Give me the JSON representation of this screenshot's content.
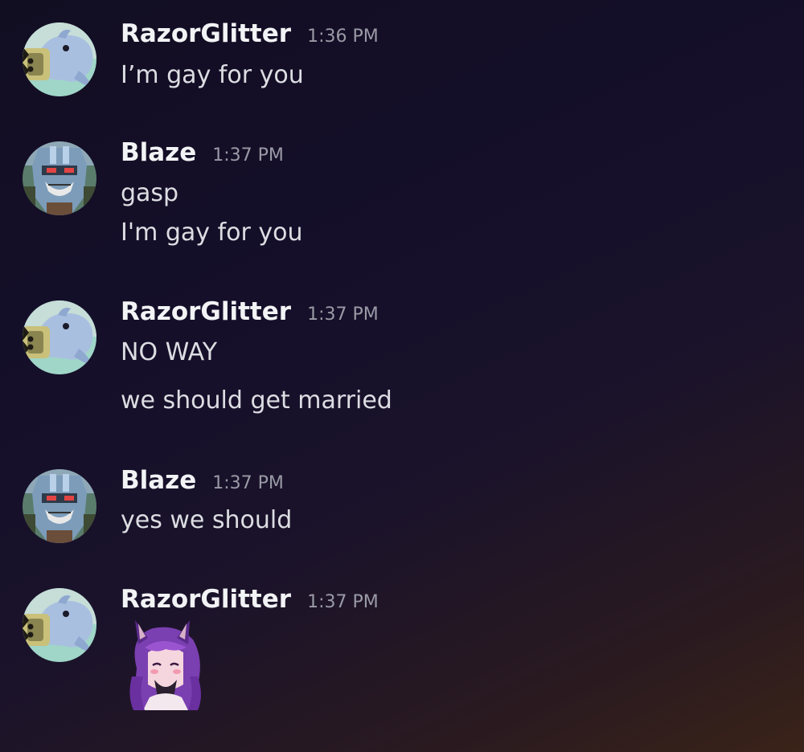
{
  "messages": [
    {
      "author": "RazorGlitter",
      "time": "1:36 PM",
      "avatar_icon": "shark-avatar-icon",
      "lines": [
        "I’m gay for you"
      ]
    },
    {
      "author": "Blaze",
      "time": "1:37 PM",
      "avatar_icon": "robot-avatar-icon",
      "lines": [
        "gasp",
        "I'm gay for you"
      ]
    },
    {
      "author": "RazorGlitter",
      "time": "1:37 PM",
      "avatar_icon": "shark-avatar-icon",
      "lines": [
        "NO WAY",
        "we should get married"
      ]
    },
    {
      "author": "Blaze",
      "time": "1:37 PM",
      "avatar_icon": "robot-avatar-icon",
      "lines": [
        "yes we should"
      ]
    },
    {
      "author": "RazorGlitter",
      "time": "1:37 PM",
      "avatar_icon": "shark-avatar-icon",
      "sticker_icon": "purple-hair-cat-girl-sticker-icon",
      "lines": []
    }
  ],
  "colors": {
    "background_top": "#120e22",
    "background_bottom_right": "#3a2318",
    "username": "#f2f3f5",
    "timestamp": "#9a9aa6",
    "message_text": "#dcdde2"
  }
}
